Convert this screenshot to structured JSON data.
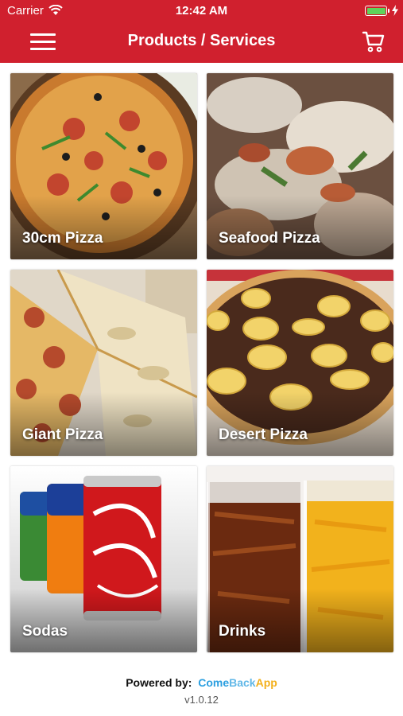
{
  "status_bar": {
    "carrier": "Carrier",
    "time": "12:42 AM"
  },
  "header": {
    "title": "Products / Services",
    "menu_icon": "hamburger-icon",
    "cart_icon": "shopping-cart-icon"
  },
  "tiles": [
    {
      "label": "30cm Pizza"
    },
    {
      "label": "Seafood Pizza"
    },
    {
      "label": "Giant Pizza"
    },
    {
      "label": "Desert Pizza"
    },
    {
      "label": "Sodas"
    },
    {
      "label": "Drinks"
    }
  ],
  "footer": {
    "powered_by": "Powered by:",
    "brand_part1": "Come",
    "brand_part2": "Back",
    "brand_part3": "App",
    "version": "v1.0.12"
  },
  "colors": {
    "header": "#d0202e",
    "brand_blue": "#2b9fe0",
    "brand_orange": "#f3b01c",
    "battery": "#5fd35a"
  }
}
